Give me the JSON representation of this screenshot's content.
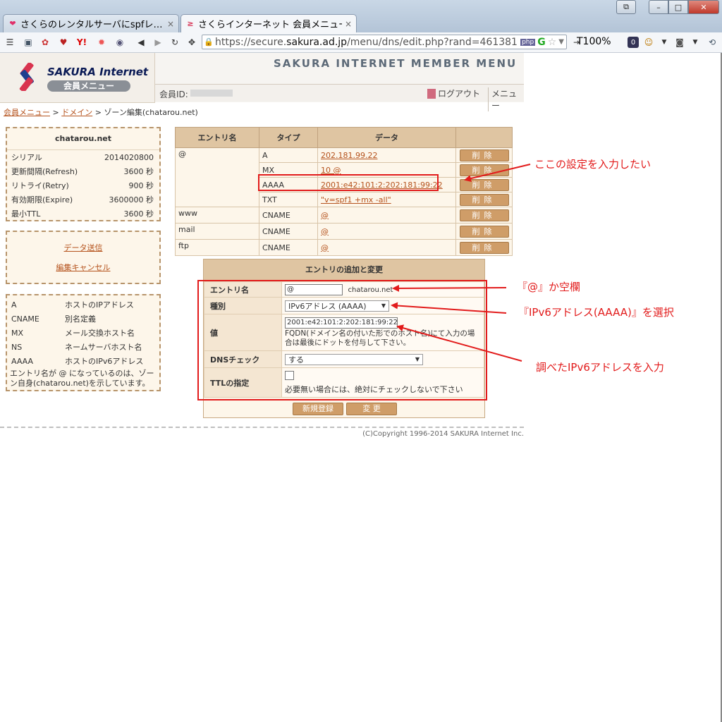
{
  "browser": {
    "tabs": [
      {
        "title": "さくらのレンタルサーバにspfレ…",
        "active": false
      },
      {
        "title": "さくらインターネット 会員メニュー…",
        "active": true
      }
    ],
    "tab_close_glyph": "×",
    "url_prefix": "https://secure.",
    "url_domain": "sakura.ad.jp",
    "url_path": "/menu/dns/edit.php?rand=461381",
    "zoom": "T100%"
  },
  "header": {
    "logo_text": "SAKURA Internet",
    "logo_sub": "会員メニュー",
    "title": "SAKURA INTERNET MEMBER MENU",
    "member_id_label": "会員ID:",
    "logout": "ログアウト",
    "menu": "メニュー"
  },
  "breadcrumb": {
    "items": [
      "会員メニュー",
      "ドメイン"
    ],
    "separator": " > ",
    "current": "ゾーン編集(chatarou.net)"
  },
  "zone": {
    "domain": "chatarou.net",
    "rows": [
      {
        "label": "シリアル",
        "value": "2014020800"
      },
      {
        "label": "更新間隔(Refresh)",
        "value": "3600 秒"
      },
      {
        "label": "リトライ(Retry)",
        "value": "900 秒"
      },
      {
        "label": "有効期限(Expire)",
        "value": "3600000 秒"
      },
      {
        "label": "最小TTL",
        "value": "3600 秒"
      }
    ]
  },
  "actions": {
    "send": "データ送信",
    "cancel": "編集キャンセル"
  },
  "legend": {
    "rows": [
      {
        "type": "A",
        "desc": "ホストのIPアドレス"
      },
      {
        "type": "CNAME",
        "desc": "別名定義"
      },
      {
        "type": "MX",
        "desc": "メール交換ホスト名"
      },
      {
        "type": "NS",
        "desc": "ネームサーバホスト名"
      },
      {
        "type": "AAAA",
        "desc": "ホストのIPv6アドレス"
      }
    ],
    "note": "エントリ名が @ になっているのは、ゾーン自身(chatarou.net)を示しています。"
  },
  "entries": {
    "headers": [
      "エントリ名",
      "タイプ",
      "データ",
      ""
    ],
    "delete_label": "削除",
    "groups": [
      {
        "name": "@",
        "records": [
          {
            "type": "A",
            "data": "202.181.99.22"
          },
          {
            "type": "MX",
            "data": "10 @"
          },
          {
            "type": "AAAA",
            "data": "2001:e42:101:2:202:181:99:22"
          },
          {
            "type": "TXT",
            "data": "\"v=spf1 +mx -all\""
          }
        ]
      },
      {
        "name": "www",
        "records": [
          {
            "type": "CNAME",
            "data": "@"
          }
        ]
      },
      {
        "name": "mail",
        "records": [
          {
            "type": "CNAME",
            "data": "@"
          }
        ]
      },
      {
        "name": "ftp",
        "records": [
          {
            "type": "CNAME",
            "data": "@"
          }
        ]
      }
    ]
  },
  "form": {
    "title": "エントリの追加と変更",
    "entry_name_label": "エントリ名",
    "entry_name_value": "@",
    "entry_name_suffix": "chatarou.net",
    "type_label": "種別",
    "type_value": "IPv6アドレス (AAAA)",
    "value_label": "値",
    "value_value": "2001:e42:101:2:202:181:99:22",
    "value_help": "FQDN(ドメイン名の付いた形でのホスト名)にて入力の場合は最後にドットを付与して下さい。",
    "dns_check_label": "DNSチェック",
    "dns_check_value": "する",
    "ttl_label": "TTLの指定",
    "ttl_help": "必要無い場合には、絶対にチェックしないで下さい",
    "register_button": "新規登録",
    "change_button": "変 更"
  },
  "footer": {
    "copyright": "(C)Copyright 1996-2014 SAKURA Internet Inc."
  },
  "annotations": [
    "ここの設定を入力したい",
    "『@』か空欄",
    "『IPv6アドレス(AAAA)』を選択",
    "調べたIPv6アドレスを入力"
  ],
  "colors": {
    "accent": "#b5521c",
    "header_cell": "#dfc5a2",
    "annotation": "#e21b1b"
  }
}
